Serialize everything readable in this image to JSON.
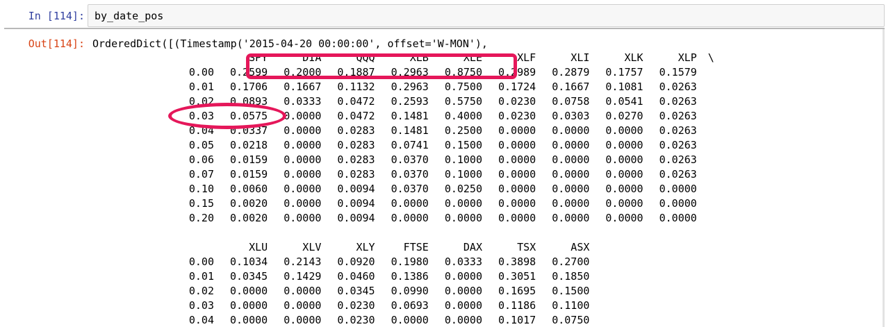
{
  "input_cell": {
    "prompt": "In [114]:",
    "code": "by_date_pos"
  },
  "output_cell": {
    "prompt": "Out[114]:",
    "first_line": "OrderedDict([(Timestamp('2015-04-20 00:00:00', offset='W-MON'),"
  },
  "table1": {
    "columns": [
      "SPY",
      "DIA",
      "QQQ",
      "XLB",
      "XLE",
      "XLF",
      "XLI",
      "XLK",
      "XLP"
    ],
    "continuation": "\\",
    "rows": [
      [
        "0.00",
        "0.2599",
        "0.2000",
        "0.1887",
        "0.2963",
        "0.8750",
        "0.2989",
        "0.2879",
        "0.1757",
        "0.1579"
      ],
      [
        "0.01",
        "0.1706",
        "0.1667",
        "0.1132",
        "0.2963",
        "0.7500",
        "0.1724",
        "0.1667",
        "0.1081",
        "0.0263"
      ],
      [
        "0.02",
        "0.0893",
        "0.0333",
        "0.0472",
        "0.2593",
        "0.5750",
        "0.0230",
        "0.0758",
        "0.0541",
        "0.0263"
      ],
      [
        "0.03",
        "0.0575",
        "0.0000",
        "0.0472",
        "0.1481",
        "0.4000",
        "0.0230",
        "0.0303",
        "0.0270",
        "0.0263"
      ],
      [
        "0.04",
        "0.0337",
        "0.0000",
        "0.0283",
        "0.1481",
        "0.2500",
        "0.0000",
        "0.0000",
        "0.0000",
        "0.0263"
      ],
      [
        "0.05",
        "0.0218",
        "0.0000",
        "0.0283",
        "0.0741",
        "0.1500",
        "0.0000",
        "0.0000",
        "0.0000",
        "0.0263"
      ],
      [
        "0.06",
        "0.0159",
        "0.0000",
        "0.0283",
        "0.0370",
        "0.1000",
        "0.0000",
        "0.0000",
        "0.0000",
        "0.0263"
      ],
      [
        "0.07",
        "0.0159",
        "0.0000",
        "0.0283",
        "0.0370",
        "0.1000",
        "0.0000",
        "0.0000",
        "0.0000",
        "0.0263"
      ],
      [
        "0.10",
        "0.0060",
        "0.0000",
        "0.0094",
        "0.0370",
        "0.0250",
        "0.0000",
        "0.0000",
        "0.0000",
        "0.0000"
      ],
      [
        "0.15",
        "0.0020",
        "0.0000",
        "0.0094",
        "0.0000",
        "0.0000",
        "0.0000",
        "0.0000",
        "0.0000",
        "0.0000"
      ],
      [
        "0.20",
        "0.0020",
        "0.0000",
        "0.0094",
        "0.0000",
        "0.0000",
        "0.0000",
        "0.0000",
        "0.0000",
        "0.0000"
      ]
    ]
  },
  "table2": {
    "columns": [
      "XLU",
      "XLV",
      "XLY",
      "FTSE",
      "DAX",
      "TSX",
      "ASX"
    ],
    "rows": [
      [
        "0.00",
        "0.1034",
        "0.2143",
        "0.0920",
        "0.1980",
        "0.0333",
        "0.3898",
        "0.2700"
      ],
      [
        "0.01",
        "0.0345",
        "0.1429",
        "0.0460",
        "0.1386",
        "0.0000",
        "0.3051",
        "0.1850"
      ],
      [
        "0.02",
        "0.0000",
        "0.0000",
        "0.0345",
        "0.0990",
        "0.0000",
        "0.1695",
        "0.1500"
      ],
      [
        "0.03",
        "0.0000",
        "0.0000",
        "0.0230",
        "0.0693",
        "0.0000",
        "0.1186",
        "0.1100"
      ],
      [
        "0.04",
        "0.0000",
        "0.0000",
        "0.0230",
        "0.0000",
        "0.0000",
        "0.1017",
        "0.0750"
      ]
    ]
  },
  "colors": {
    "in_prompt": "#303f9f",
    "out_prompt": "#d84315",
    "annotation": "#e5175a",
    "input_bg": "#f7f7f7"
  }
}
